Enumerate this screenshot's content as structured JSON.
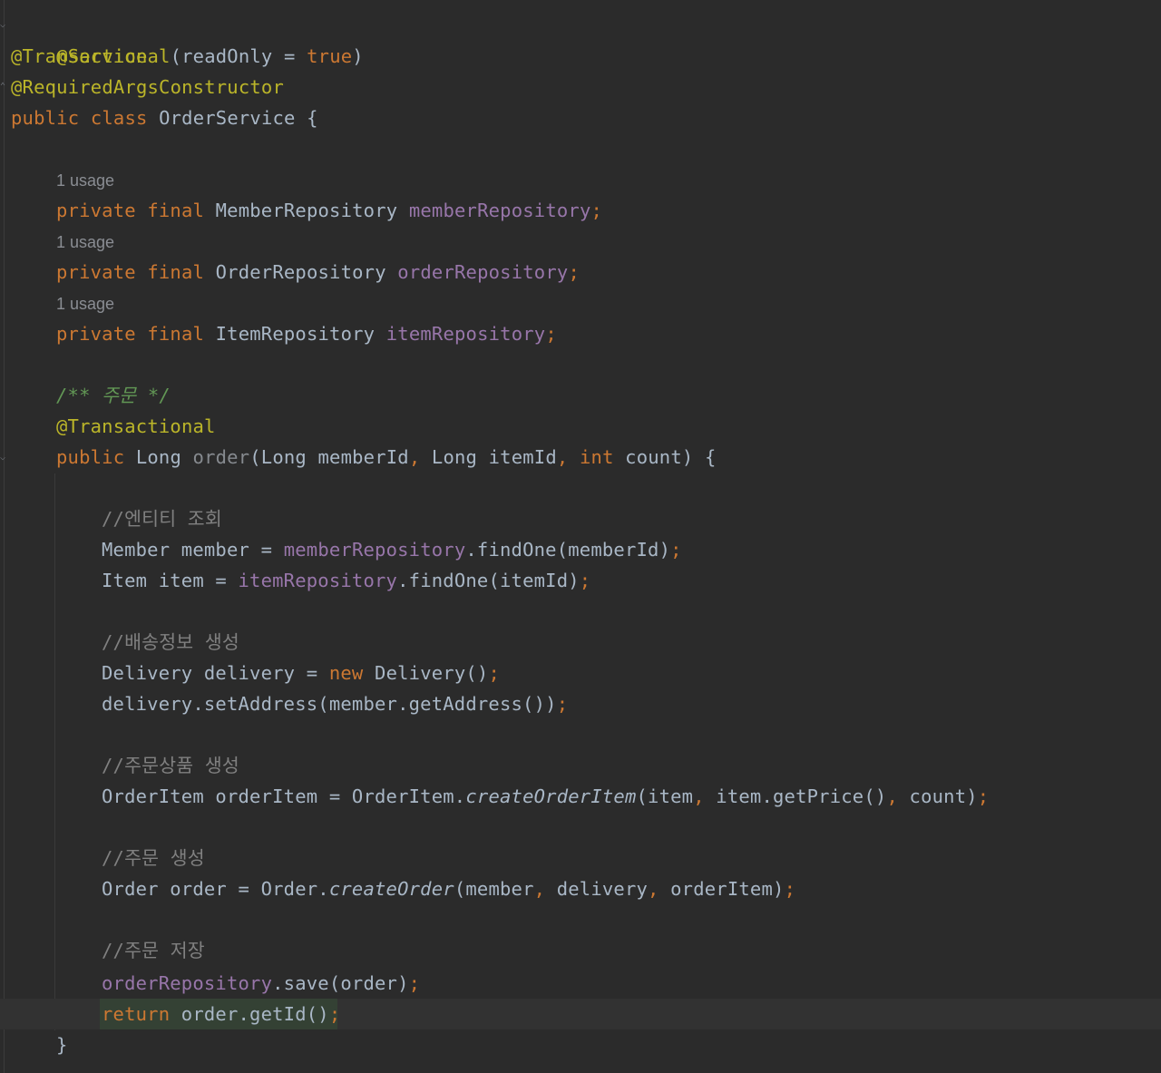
{
  "code": {
    "ann_service": "@Service",
    "ann_transactional": "@Transactional",
    "tx_args_open": "(readOnly = ",
    "tx_true": "true",
    "tx_close": ")",
    "ann_required": "@RequiredArgsConstructor",
    "kw_public": "public",
    "kw_class": "class",
    "class_name": "OrderService {",
    "usage_hint": "1 usage",
    "kw_private": "private",
    "kw_final": "final",
    "type_member_repo": "MemberRepository",
    "field_member_repo": "memberRepository",
    "type_order_repo": "OrderRepository",
    "field_order_repo": "orderRepository",
    "type_item_repo": "ItemRepository",
    "field_item_repo": "itemRepository",
    "semicolon": ";",
    "doc_comment": "/** 주문 */",
    "ann_tx_method": "@Transactional",
    "type_long": "Long",
    "method_order": "order",
    "params_a": "(Long memberId",
    "comma": ",",
    "params_b": " Long itemId",
    "kw_int": "int",
    "params_c": " count) {",
    "cmt_entity": "//엔티티 조회",
    "member_decl": "Member member = ",
    "find_one_member": ".findOne(memberId)",
    "item_decl": "Item item = ",
    "find_one_item": ".findOne(itemId)",
    "cmt_delivery": "//배송정보 생성",
    "delivery_decl": "Delivery delivery = ",
    "kw_new": "new",
    "delivery_ctor": " Delivery()",
    "set_address": "delivery.setAddress(member.getAddress())",
    "cmt_order_item": "//주문상품 생성",
    "order_item_decl": "OrderItem orderItem = OrderItem.",
    "create_order_item": "createOrderItem",
    "coi_arg1": "(item",
    "coi_arg2": " item.getPrice()",
    "coi_arg3": " count)",
    "cmt_order_create": "//주문 생성",
    "order_decl": "Order order = Order.",
    "create_order": "createOrder",
    "co_arg1": "(member",
    "co_arg2": " delivery",
    "co_arg3": " orderItem)",
    "cmt_save": "//주문 저장",
    "save_call": ".save(order)",
    "kw_return": "return",
    "return_expr": " order.getId()",
    "close_brace": "}"
  },
  "colors": {
    "background": "#2b2b2b",
    "keyword": "#cc7832",
    "annotation": "#bbb529",
    "field": "#9876aa",
    "text": "#a9b7c6",
    "comment": "#808080",
    "doc_comment": "#629755"
  }
}
